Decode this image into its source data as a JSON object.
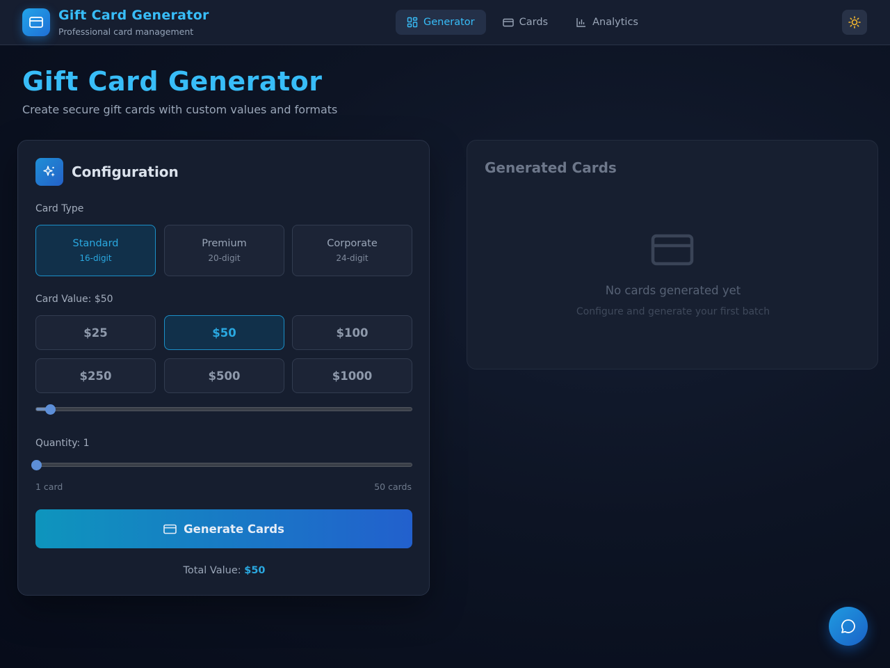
{
  "header": {
    "brand_title": "Gift Card Generator",
    "brand_subtitle": "Professional card management",
    "nav": [
      {
        "label": "Generator",
        "icon": "grid-icon",
        "active": true
      },
      {
        "label": "Cards",
        "icon": "card-icon",
        "active": false
      },
      {
        "label": "Analytics",
        "icon": "bar-chart-icon",
        "active": false
      }
    ],
    "theme_icon": "sun-icon"
  },
  "page": {
    "title": "Gift Card Generator",
    "subtitle": "Create secure gift cards with custom values and formats"
  },
  "config": {
    "title": "Configuration",
    "card_type_label": "Card Type",
    "card_types": [
      {
        "name": "Standard",
        "digits": "16-digit",
        "selected": true
      },
      {
        "name": "Premium",
        "digits": "20-digit",
        "selected": false
      },
      {
        "name": "Corporate",
        "digits": "24-digit",
        "selected": false
      }
    ],
    "card_value_label": "Card Value: $50",
    "values": [
      "$25",
      "$50",
      "$100",
      "$250",
      "$500",
      "$1000"
    ],
    "selected_value": "$50",
    "value_slider_fraction": 0.037,
    "quantity_label": "Quantity: 1",
    "quantity_slider_fraction": 0,
    "quantity_min_label": "1 card",
    "quantity_max_label": "50 cards",
    "generate_label": "Generate Cards",
    "total_label": "Total Value:",
    "total_value": "$50"
  },
  "generated": {
    "title": "Generated Cards",
    "empty_title": "No cards generated yet",
    "empty_subtitle": "Configure and generate your first batch"
  },
  "colors": {
    "accent": "#38bdf8",
    "selected": "#2aa8e0",
    "button_gradient_start": "#0e95bd",
    "button_gradient_end": "#2260cd"
  }
}
